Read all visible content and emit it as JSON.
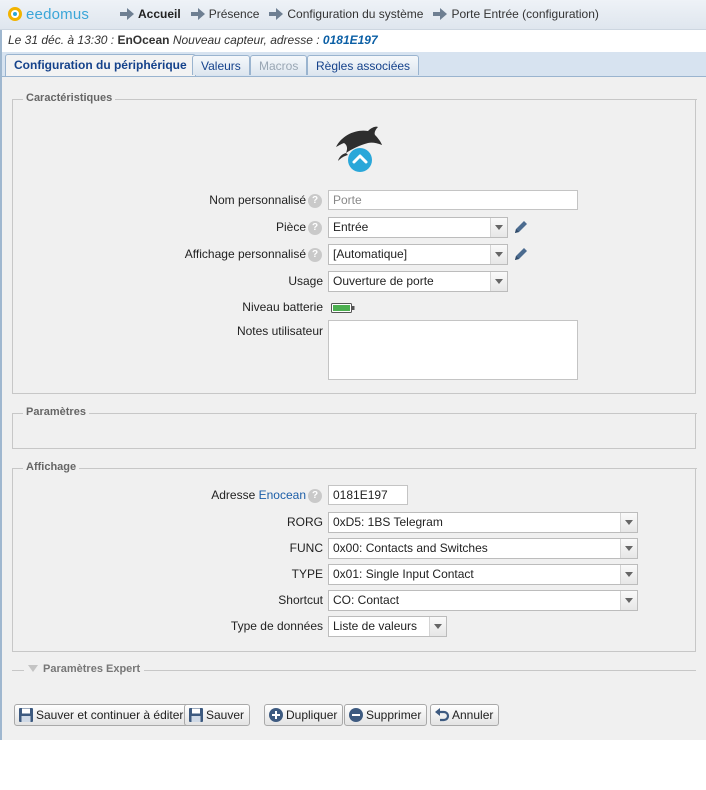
{
  "app": {
    "logo_text": "eedomus"
  },
  "breadcrumb": [
    {
      "label": "Accueil",
      "current": true
    },
    {
      "label": "Présence"
    },
    {
      "label": "Configuration du système"
    },
    {
      "label": "Porte Entrée (configuration)"
    }
  ],
  "notification": {
    "date": "Le 31 déc. à 13:30 :",
    "source": "EnOcean",
    "message": "Nouveau capteur, adresse :",
    "address": "0181E197"
  },
  "tabs": [
    {
      "label": "Configuration du périphérique",
      "state": "active"
    },
    {
      "label": "Valeurs",
      "state": "normal"
    },
    {
      "label": "Macros",
      "state": "disabled"
    },
    {
      "label": "Règles associées",
      "state": "normal"
    }
  ],
  "caracteristiques": {
    "legend": "Caractéristiques",
    "device_icon": "dolphin-icon",
    "nom": {
      "label": "Nom personnalisé",
      "placeholder": "Porte"
    },
    "piece": {
      "label": "Pièce",
      "value": "Entrée"
    },
    "affichage": {
      "label": "Affichage personnalisé",
      "value": "[Automatique]"
    },
    "usage": {
      "label": "Usage",
      "value": "Ouverture de porte"
    },
    "batterie": {
      "label": "Niveau batterie",
      "level": 1.0,
      "color": "#4caf50"
    },
    "notes": {
      "label": "Notes utilisateur",
      "value": ""
    }
  },
  "parametres": {
    "legend": "Paramètres"
  },
  "affichage_section": {
    "legend": "Affichage",
    "adresse": {
      "label_prefix": "Adresse",
      "label_link": "Enocean",
      "value": "0181E197"
    },
    "rorg": {
      "label": "RORG",
      "value": "0xD5: 1BS Telegram"
    },
    "func": {
      "label": "FUNC",
      "value": "0x00: Contacts and Switches"
    },
    "type": {
      "label": "TYPE",
      "value": "0x01: Single Input Contact"
    },
    "shortcut": {
      "label": "Shortcut",
      "value": "CO: Contact"
    },
    "type_donnees": {
      "label": "Type de données",
      "value": "Liste de valeurs"
    }
  },
  "expert": {
    "legend": "Paramètres Expert"
  },
  "buttons": {
    "save_continue": "Sauver et continuer à éditer",
    "save": "Sauver",
    "duplicate": "Dupliquer",
    "delete": "Supprimer",
    "cancel": "Annuler"
  },
  "colors": {
    "accent": "#15428b",
    "link": "#1d5fa8",
    "icon_blue": "#2aa7d9"
  }
}
